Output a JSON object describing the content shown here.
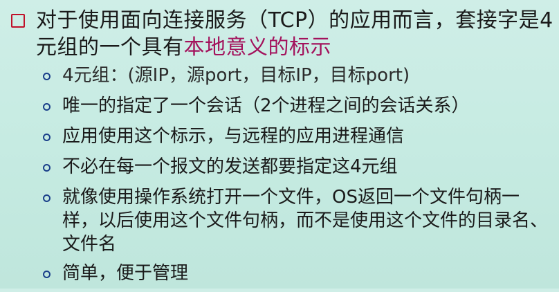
{
  "slide": {
    "main": {
      "text_before": "对于使用面向连接服务（TCP）的应用而言，套接字是4元组的一个具有",
      "highlight": "本地意义的标示"
    },
    "items": [
      {
        "text": "4元组：(源IP，源port，目标IP，目标port)"
      },
      {
        "text": "唯一的指定了一个会话（2个进程之间的会话关系）"
      },
      {
        "text": "应用使用这个标示，与远程的应用进程通信"
      },
      {
        "text": "不必在每一个报文的发送都要指定这4元组"
      },
      {
        "text": "就像使用操作系统打开一个文件，OS返回一个文件句柄一样，以后使用这个文件句柄，而不是使用这个文件的目录名、文件名"
      },
      {
        "text": "简单，便于管理"
      }
    ],
    "colors": {
      "background": "#c9ece4",
      "square_bullet": "#c0112a",
      "circle_bullet": "#1a3f8a",
      "highlight": "#a3125c"
    }
  }
}
